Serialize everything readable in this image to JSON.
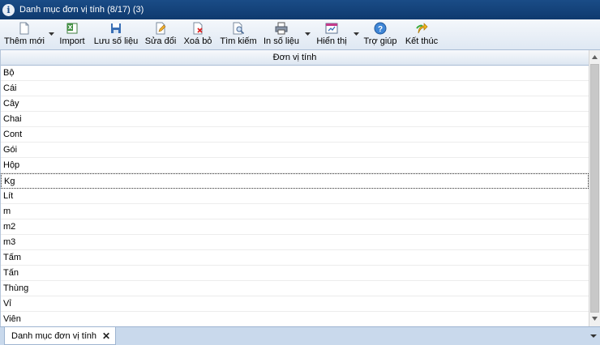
{
  "window": {
    "title": "Danh mục đơn vị tính (8/17) (3)"
  },
  "toolbar": {
    "buttons": [
      {
        "label": "Thêm mới",
        "icon": "new-document-icon"
      },
      {
        "label": "Import",
        "icon": "excel-icon"
      },
      {
        "label": "Lưu số liệu",
        "icon": "save-icon"
      },
      {
        "label": "Sửa đổi",
        "icon": "edit-icon"
      },
      {
        "label": "Xoá bỏ",
        "icon": "delete-icon"
      },
      {
        "label": "Tìm kiếm",
        "icon": "search-icon"
      },
      {
        "label": "In số liệu",
        "icon": "printer-icon"
      },
      {
        "label": "Hiển thị",
        "icon": "display-icon"
      },
      {
        "label": "Trợ giúp",
        "icon": "help-icon"
      },
      {
        "label": "Kết thúc",
        "icon": "exit-icon"
      }
    ]
  },
  "grid": {
    "header": "Đơn vị tính",
    "rows": [
      "Bộ",
      "Cái",
      "Cây",
      "Chai",
      "Cont",
      "Gói",
      "Hộp",
      "Kg",
      "Lít",
      "m",
      "m2",
      "m3",
      "Tấm",
      "Tấn",
      "Thùng",
      "Vỉ",
      "Viên"
    ],
    "focused_row": "Kg"
  },
  "tabs": [
    {
      "label": "Danh mục đơn vị tính"
    }
  ],
  "colors": {
    "titlebar": "#1a4c87",
    "toolbar": "#dfe8f3",
    "tabbar": "#c9d9ec"
  }
}
